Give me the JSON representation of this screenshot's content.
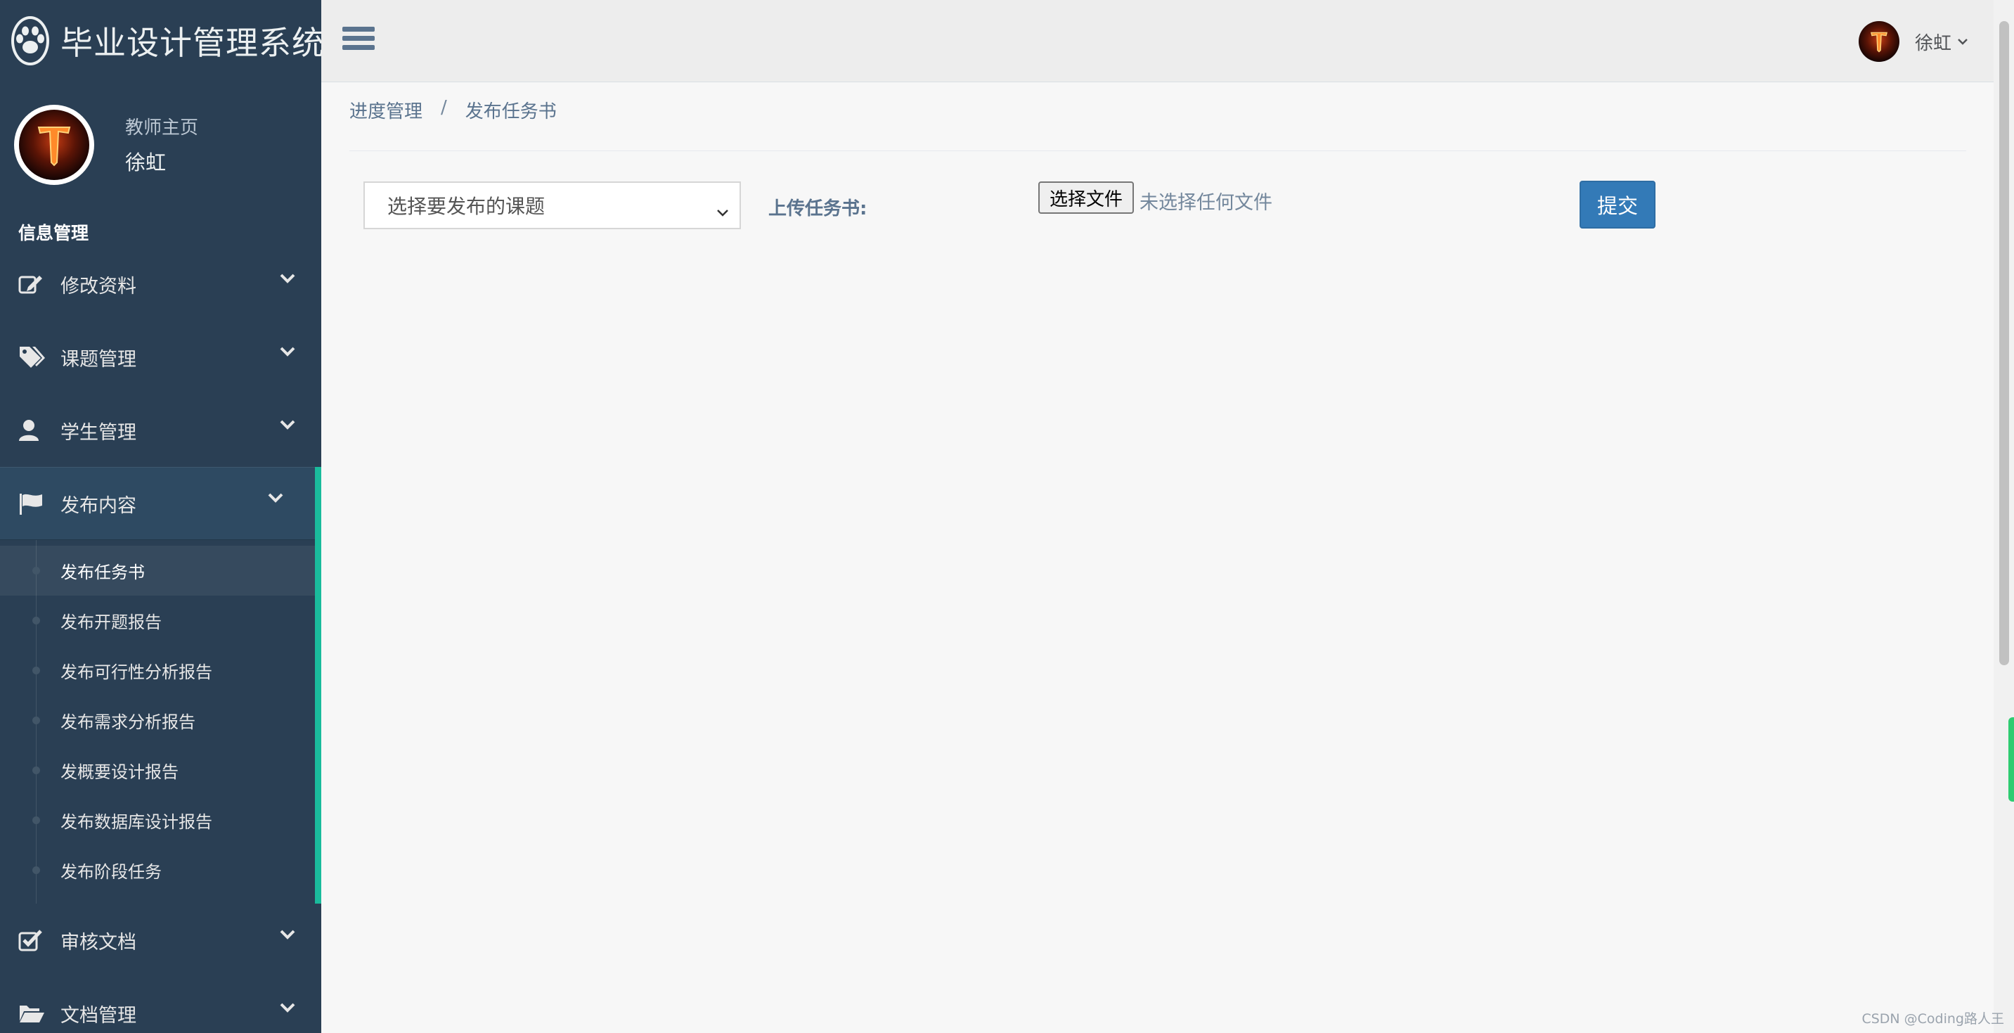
{
  "brand": {
    "title": "毕业设计管理系统",
    "icon": "paw-icon"
  },
  "profile": {
    "welcome": "教师主页",
    "name": "徐虹"
  },
  "sidebar": {
    "section_title": "信息管理",
    "items": [
      {
        "label": "修改资料",
        "icon": "edit-icon"
      },
      {
        "label": "课题管理",
        "icon": "tags-icon"
      },
      {
        "label": "学生管理",
        "icon": "user-icon"
      },
      {
        "label": "发布内容",
        "icon": "flag-icon",
        "expanded": true,
        "children": [
          "发布任务书",
          "发布开题报告",
          "发布可行性分析报告",
          "发布需求分析报告",
          "发概要设计报告",
          "发布数据库设计报告",
          "发布阶段任务"
        ]
      },
      {
        "label": "审核文档",
        "icon": "check-square-icon"
      },
      {
        "label": "文档管理",
        "icon": "folder-open-icon"
      }
    ]
  },
  "topnav": {
    "user_name": "徐虹",
    "menu_icon": "hamburger-icon"
  },
  "breadcrumb": {
    "parent": "进度管理",
    "separator": "/",
    "current": "发布任务书"
  },
  "form": {
    "select_placeholder": "选择要发布的课题",
    "upload_label": "上传任务书:",
    "file_button": "选择文件",
    "file_status": "未选择任何文件",
    "submit_label": "提交"
  },
  "watermark": "CSDN @Coding路人王",
  "colors": {
    "sidebar_bg": "#2a3f54",
    "active_accent": "#1abb9c",
    "primary": "#337ab7",
    "text_muted": "#5a738e"
  }
}
